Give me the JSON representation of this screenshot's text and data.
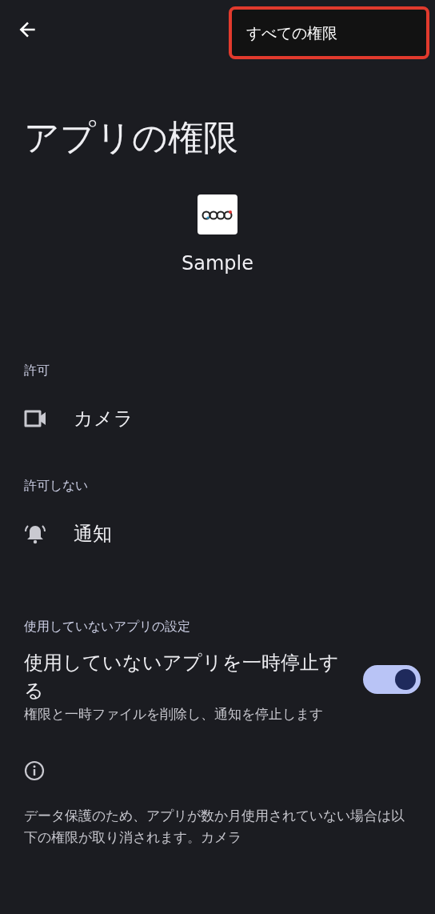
{
  "menu": {
    "items": [
      {
        "label": "すべての権限"
      }
    ]
  },
  "title": "アプリの権限",
  "app": {
    "name": "Sample"
  },
  "sections": [
    {
      "header": "許可",
      "items": [
        {
          "kind": "camera",
          "label": "カメラ"
        }
      ]
    },
    {
      "header": "許可しない",
      "items": [
        {
          "kind": "bell",
          "label": "通知"
        }
      ]
    }
  ],
  "unused_settings": {
    "header": "使用していないアプリの設定",
    "title": "使用していないアプリを一時停止する",
    "subtitle": "権限と一時ファイルを削除し、通知を停止します",
    "on": true
  },
  "info": {
    "text": "データ保護のため、アプリが数か月使用されていない場合は以下の権限が取り消されます。カメラ"
  }
}
